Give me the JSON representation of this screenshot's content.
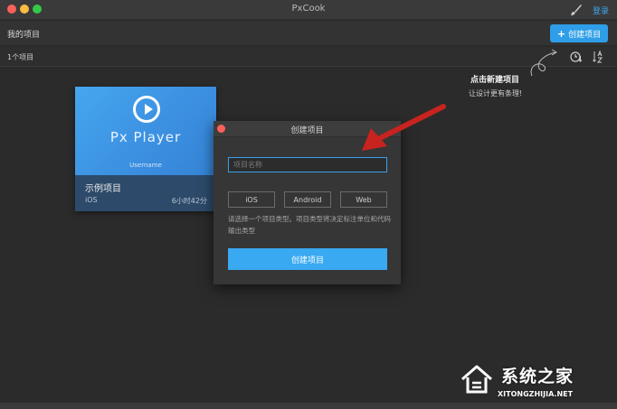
{
  "window": {
    "title": "PxCook",
    "login": "登录"
  },
  "header": {
    "my_projects": "我的项目",
    "create_button": "创建项目",
    "create_plus": "+"
  },
  "subheader": {
    "count": "1个项目"
  },
  "hint": {
    "title": "点击新建项目",
    "subtitle": "让设计更有条理!"
  },
  "card": {
    "thumb_title": "Px Player",
    "thumb_user": "Username",
    "name": "示例项目",
    "platform": "iOS",
    "time": "6小时42分"
  },
  "dialog": {
    "title": "创建项目",
    "name_placeholder": "项目名称",
    "types": [
      "iOS",
      "Android",
      "Web"
    ],
    "description": "请选择一个项目类型。项目类型将决定标注单位和代码输出类型",
    "submit": "创建项目"
  },
  "watermark": {
    "name": "系统之家",
    "url": "XITONGZHIJIA.NET"
  },
  "icons": {
    "brush": "brush-icon",
    "clock_sort": "clock-sort-icon",
    "az_sort": "az-sort-icon",
    "play": "play-icon"
  },
  "colors": {
    "accent": "#2f9ee8",
    "close": "#fc605c",
    "annotation": "#c8231e"
  }
}
